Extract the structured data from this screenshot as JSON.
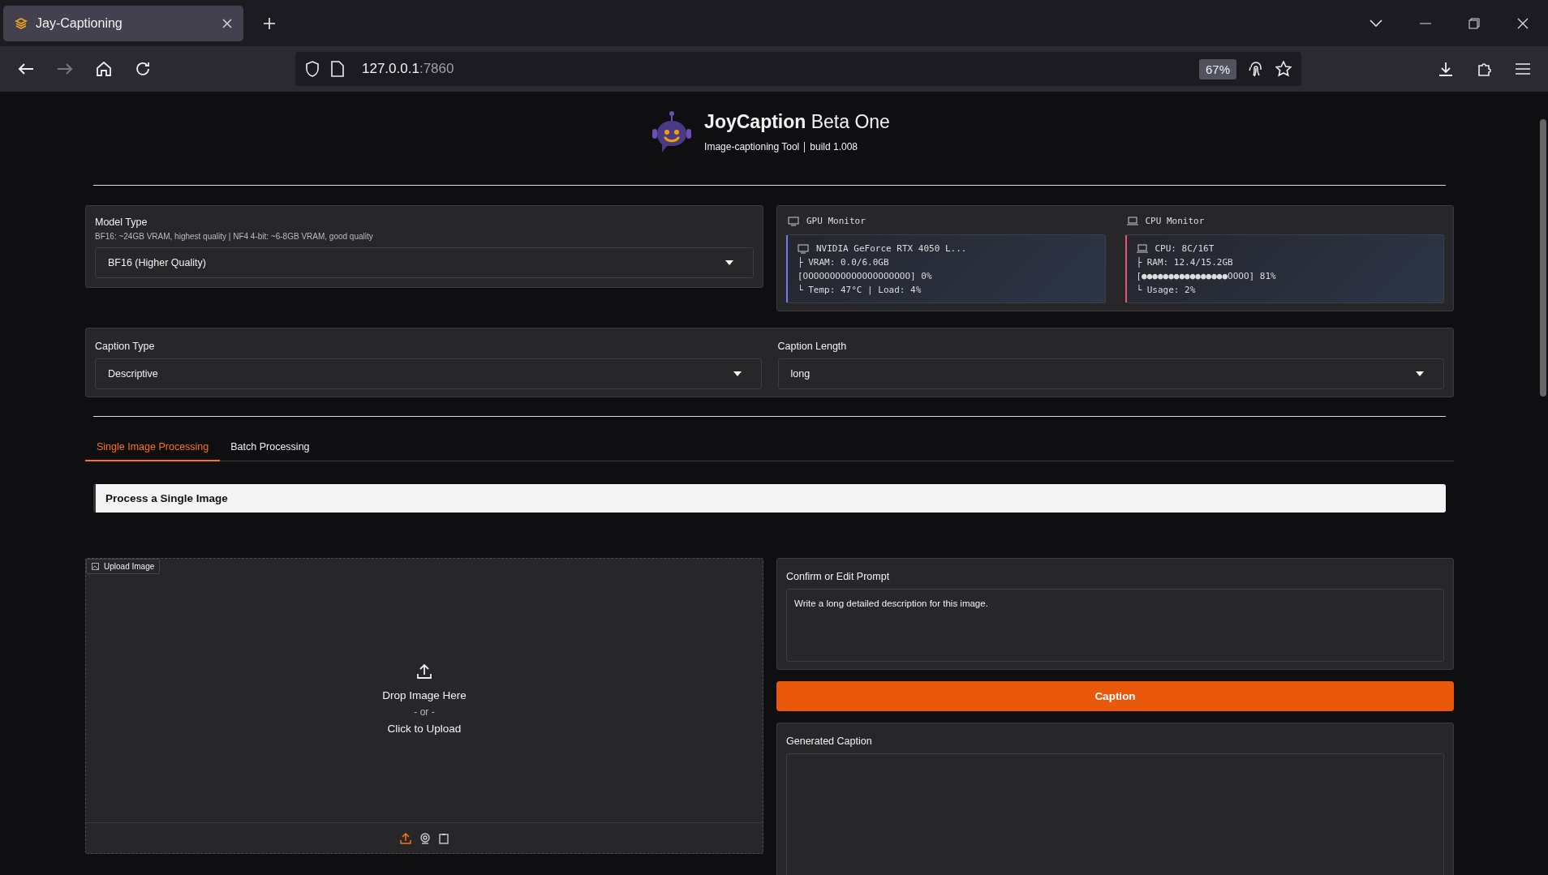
{
  "browser": {
    "tab_title": "Jay-Captioning",
    "url_host": "127.0.0.1",
    "url_port": ":7860",
    "zoom": "67%"
  },
  "header": {
    "title_bold": "JoyCaption",
    "title_rest": "Beta One",
    "subtitle": "Image-captioning Tool",
    "build": "build 1.008"
  },
  "model": {
    "label": "Model Type",
    "info": "BF16: ~24GB VRAM, highest quality | NF4 4-bit: ~6-8GB VRAM, good quality",
    "value": "BF16 (Higher Quality)"
  },
  "monitors": [
    {
      "kind": "gpu",
      "title": "GPU Monitor",
      "color": "#6d7cf0",
      "lines": [
        "NVIDIA GeForce RTX 4050 L...",
        "├ VRAM: 0.0/6.0GB",
        "[OOOOOOOOOOOOOOOOOOOO] 0%",
        "└ Temp: 47°C | Load: 4%"
      ]
    },
    {
      "kind": "cpu",
      "title": "CPU Monitor",
      "color": "#e8566e",
      "lines": [
        "CPU: 8C/16T",
        "├ RAM: 12.4/15.2GB",
        "[●●●●●●●●●●●●●●●●OOOO] 81%",
        "└ Usage: 2%"
      ]
    }
  ],
  "caption_type": {
    "label": "Caption Type",
    "value": "Descriptive"
  },
  "caption_length": {
    "label": "Caption Length",
    "value": "long"
  },
  "tabs": [
    {
      "label": "Single Image Processing",
      "selected": true
    },
    {
      "label": "Batch Processing",
      "selected": false
    }
  ],
  "section_heading": "Process a Single Image",
  "upload": {
    "label": "Upload Image",
    "drop": "Drop Image Here",
    "or": "- or -",
    "click": "Click to Upload",
    "sources": [
      {
        "kind": "upload",
        "selected": true
      },
      {
        "kind": "webcam",
        "selected": false
      },
      {
        "kind": "clipboard",
        "selected": false
      }
    ]
  },
  "prompt": {
    "label": "Confirm or Edit Prompt",
    "value": "Write a long detailed description for this image."
  },
  "caption_button": "Caption",
  "generated": {
    "label": "Generated Caption"
  }
}
